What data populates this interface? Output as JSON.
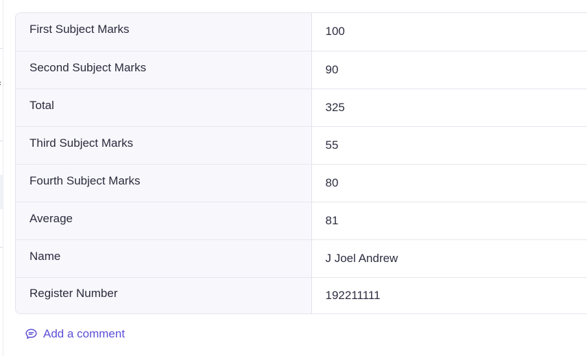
{
  "rows": [
    {
      "label": "First Subject Marks",
      "value": "100"
    },
    {
      "label": "Second Subject Marks",
      "value": "90"
    },
    {
      "label": "Total",
      "value": "325"
    },
    {
      "label": "Third Subject Marks",
      "value": "55"
    },
    {
      "label": "Fourth Subject Marks",
      "value": "80"
    },
    {
      "label": "Average",
      "value": "81"
    },
    {
      "label": "Name",
      "value": "J Joel Andrew"
    },
    {
      "label": "Register Number",
      "value": "192211111"
    }
  ],
  "comment": {
    "label": "Add a comment",
    "icon": "comment-icon",
    "color": "#5b4fd6"
  },
  "colors": {
    "key_background": "#f8f7fc",
    "border": "#e3e3ec"
  }
}
